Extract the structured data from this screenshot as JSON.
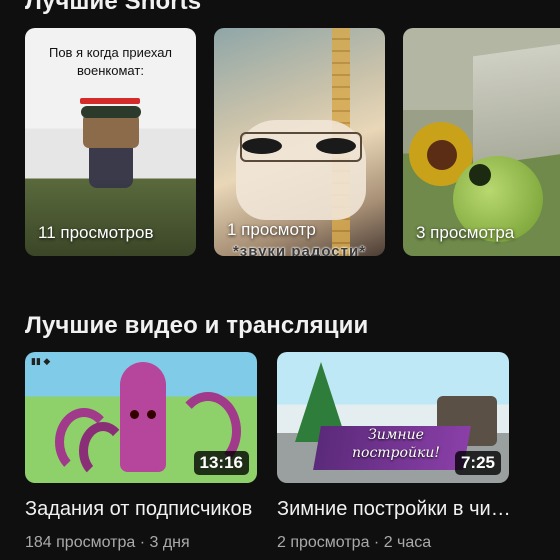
{
  "shorts_section": {
    "title": "Лучшие Shorts",
    "items": [
      {
        "views": "11 просмотров",
        "caption_line1": "Пов я когда приехал",
        "caption_line2": "военкомат:"
      },
      {
        "views": "1 просмотр",
        "overlay": "*звуки радости*"
      },
      {
        "views": "3 просмотра"
      }
    ]
  },
  "videos_section": {
    "title": "Лучшие видео и трансляции",
    "items": [
      {
        "duration": "13:16",
        "title": "Задания от подписчиков",
        "meta": "184 просмотра · 3 дня"
      },
      {
        "duration": "7:25",
        "title": "Зимние постройки в чикен ган",
        "meta": "2 просмотра · 2 часа",
        "thumb_text_line1": "Зимние",
        "thumb_text_line2": "постройки!"
      }
    ]
  }
}
